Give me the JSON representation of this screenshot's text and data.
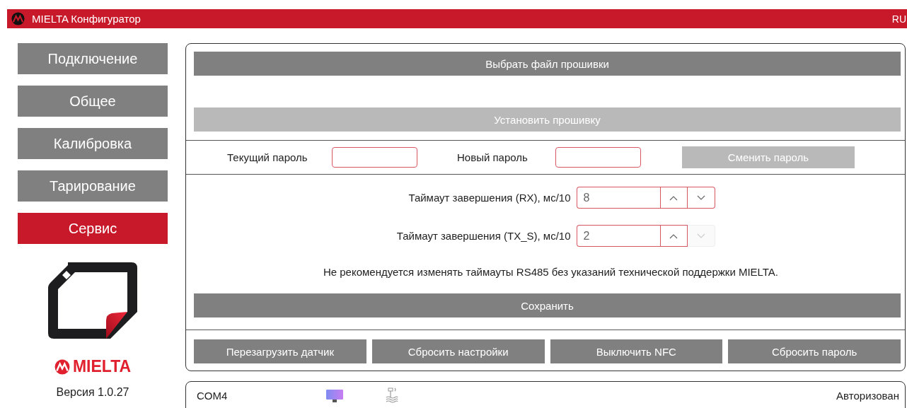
{
  "title_bar": {
    "title": "MIELTA Конфигуратор",
    "language": "RU"
  },
  "sidebar": {
    "items": [
      {
        "label": "Подключение",
        "selected": false
      },
      {
        "label": "Общее",
        "selected": false
      },
      {
        "label": "Калибровка",
        "selected": false
      },
      {
        "label": "Тарирование",
        "selected": false
      },
      {
        "label": "Сервис",
        "selected": true
      }
    ],
    "brand": "MIELTA",
    "version": "Версия  1.0.27"
  },
  "firmware": {
    "choose_button": {
      "label": "Выбрать файл прошивки",
      "disabled": false
    },
    "install_button": {
      "label": "Установить прошивку",
      "disabled": true
    }
  },
  "password": {
    "current_label": "Текущий пароль",
    "new_label": "Новый пароль",
    "change_button": {
      "label": "Сменить пароль",
      "disabled": true
    }
  },
  "timeouts": [
    {
      "label": "Таймаут завершения (RX),  мс/10",
      "value": "8",
      "up_disabled": false,
      "down_disabled": false
    },
    {
      "label": "Таймаут завершения (TX_S),  мс/10",
      "value": "2",
      "up_disabled": false,
      "down_disabled": true
    }
  ],
  "warning": "Не рекомендуется изменять таймауты RS485 без указаний технической поддержки MIELTA.",
  "save_button": {
    "label": "Сохранить",
    "disabled": false
  },
  "actions": [
    {
      "label": "Перезагрузить датчик",
      "disabled": false
    },
    {
      "label": "Сбросить настройки",
      "disabled": false
    },
    {
      "label": "Выключить NFC",
      "disabled": false
    },
    {
      "label": "Сбросить пароль",
      "disabled": false
    }
  ],
  "status_bar": {
    "port": "COM4",
    "auth": "Авторизован"
  }
}
